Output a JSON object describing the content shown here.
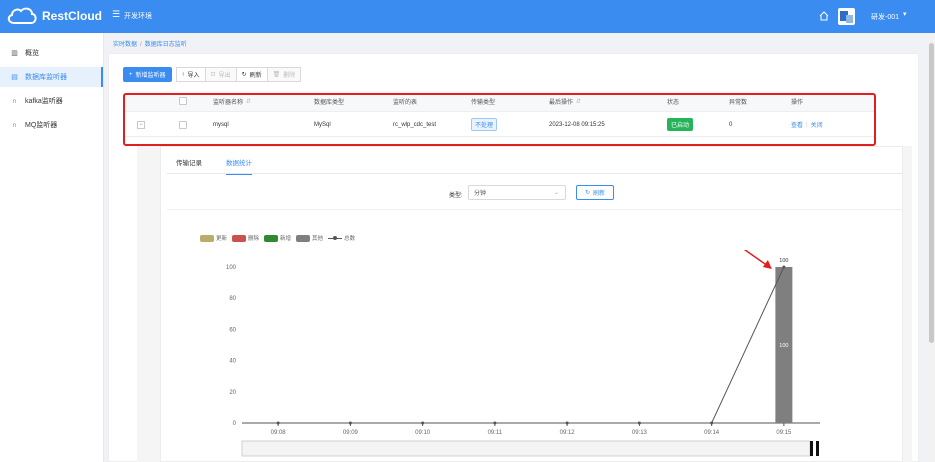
{
  "header": {
    "brand": "RestCloud",
    "menu_icon": "menu-icon",
    "environment": "开发环境",
    "user": "研发-001",
    "accent": "#3a8cf0"
  },
  "sidebar": {
    "items": [
      {
        "label": "概览",
        "icon": "bar-chart-icon",
        "active": false
      },
      {
        "label": "数据库监听器",
        "icon": "database-icon",
        "active": true
      },
      {
        "label": "kafka监听器",
        "icon": "headset-icon",
        "active": false
      },
      {
        "label": "MQ监听器",
        "icon": "headset-icon",
        "active": false
      }
    ]
  },
  "breadcrumb": [
    "实时数据",
    "数据库日志监听"
  ],
  "toolbar": {
    "new_listener": "新增监听器",
    "import": "导入",
    "export": "导出",
    "refresh": "刷新",
    "delete": "删除"
  },
  "table": {
    "headers": [
      "监听器名称",
      "数据库类型",
      "监听的表",
      "传输类型",
      "最后操作",
      "状态",
      "异常数",
      "操作"
    ],
    "rows": [
      {
        "name": "mysql",
        "db_type": "MySql",
        "table": "rc_wlp_cdc_test",
        "transfer_type": "不处理",
        "last_op": "2023-12-08 09:15:25",
        "status": "已启动",
        "errors": "0",
        "action_view": "查看",
        "action_close": "关闭"
      }
    ]
  },
  "tabs": [
    "传输记录",
    "数据统计"
  ],
  "filter": {
    "label": "类型:",
    "value": "分钟",
    "refresh": "刷新"
  },
  "chart_data": {
    "type": "bar",
    "categories": [
      "09:08",
      "09:09",
      "09:10",
      "09:11",
      "09:12",
      "09:13",
      "09:14",
      "09:15"
    ],
    "ylim": [
      0,
      100
    ],
    "yticks": [
      0,
      20,
      40,
      60,
      80,
      100
    ],
    "legend": [
      {
        "name": "更新",
        "color": "#b8ad6b"
      },
      {
        "name": "删除",
        "color": "#c9514e"
      },
      {
        "name": "新增",
        "color": "#2f8a2f"
      },
      {
        "name": "其他",
        "color": "#7f7f7f"
      },
      {
        "name": "总数",
        "color": "#555555"
      }
    ],
    "series": [
      {
        "name": "更新",
        "values": [
          0,
          0,
          0,
          0,
          0,
          0,
          0,
          0
        ]
      },
      {
        "name": "删除",
        "values": [
          0,
          0,
          0,
          0,
          0,
          0,
          0,
          0
        ]
      },
      {
        "name": "新增",
        "values": [
          0,
          0,
          0,
          0,
          0,
          0,
          0,
          0
        ]
      },
      {
        "name": "其他",
        "values": [
          0,
          0,
          0,
          0,
          0,
          0,
          0,
          100
        ]
      },
      {
        "name": "总数",
        "values": [
          0,
          0,
          0,
          0,
          0,
          0,
          0,
          100
        ]
      }
    ],
    "data_labels": {
      "bar": "100",
      "line": "100"
    }
  }
}
